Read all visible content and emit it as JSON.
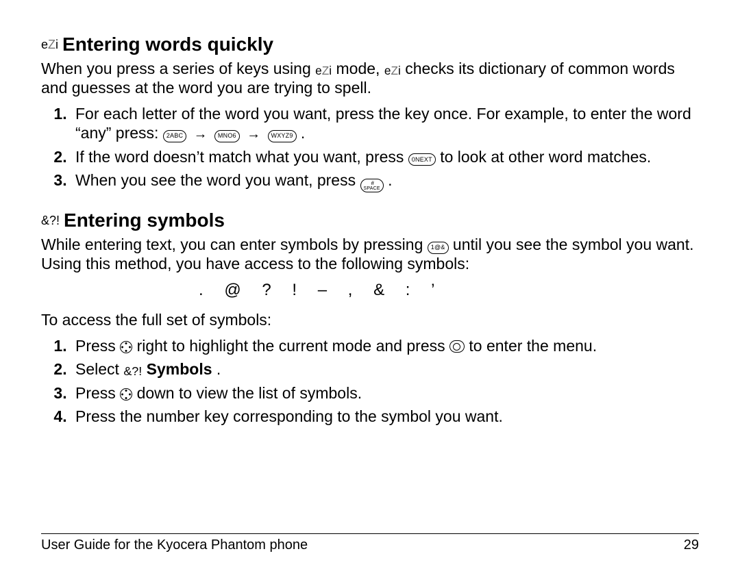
{
  "section1": {
    "icon_text": "eZi",
    "title": "Entering words quickly",
    "intro_a": "When you press a series of keys using ",
    "intro_b": " mode, ",
    "intro_c": " checks its dictionary of common words and guesses at the word you are trying to spell.",
    "step1_a": "For each letter of the word you want, press the key once. For example, to enter the word “any” press: ",
    "key_2": "2ABC",
    "key_6": "MNO6",
    "key_9": "WXYZ9",
    "step1_end": " .",
    "step2_a": "If the word doesn’t match what you want, press ",
    "key_0": "0NEXT",
    "step2_b": " to look at other word matches.",
    "step3_a": "When you see the word you want, press ",
    "key_space_top": " #",
    "key_space_bottom": "SPACE",
    "step3_end": " ."
  },
  "section2": {
    "icon_text": "&?!",
    "title": "Entering symbols",
    "intro_a": "While entering text, you can enter symbols by pressing ",
    "key_1": "1@&",
    "intro_b": " until you see the symbol you want. Using this method, you have access to the following symbols:",
    "symbols_row": ". @ ? ! – , & : ’",
    "access_line": "To access the full set of symbols:",
    "step1_a": "Press ",
    "step1_b": " right to highlight the current mode and press ",
    "step1_c": " to enter the menu.",
    "step2_a": "Select ",
    "step2_icon": "&?!",
    "step2_bold": "Symbols",
    "step2_end": ".",
    "step3_a": "Press ",
    "step3_b": " down to view the list of symbols.",
    "step4": "Press the number key corresponding to the symbol you want."
  },
  "footer": {
    "left": "User Guide for the Kyocera Phantom phone",
    "right": "29"
  }
}
